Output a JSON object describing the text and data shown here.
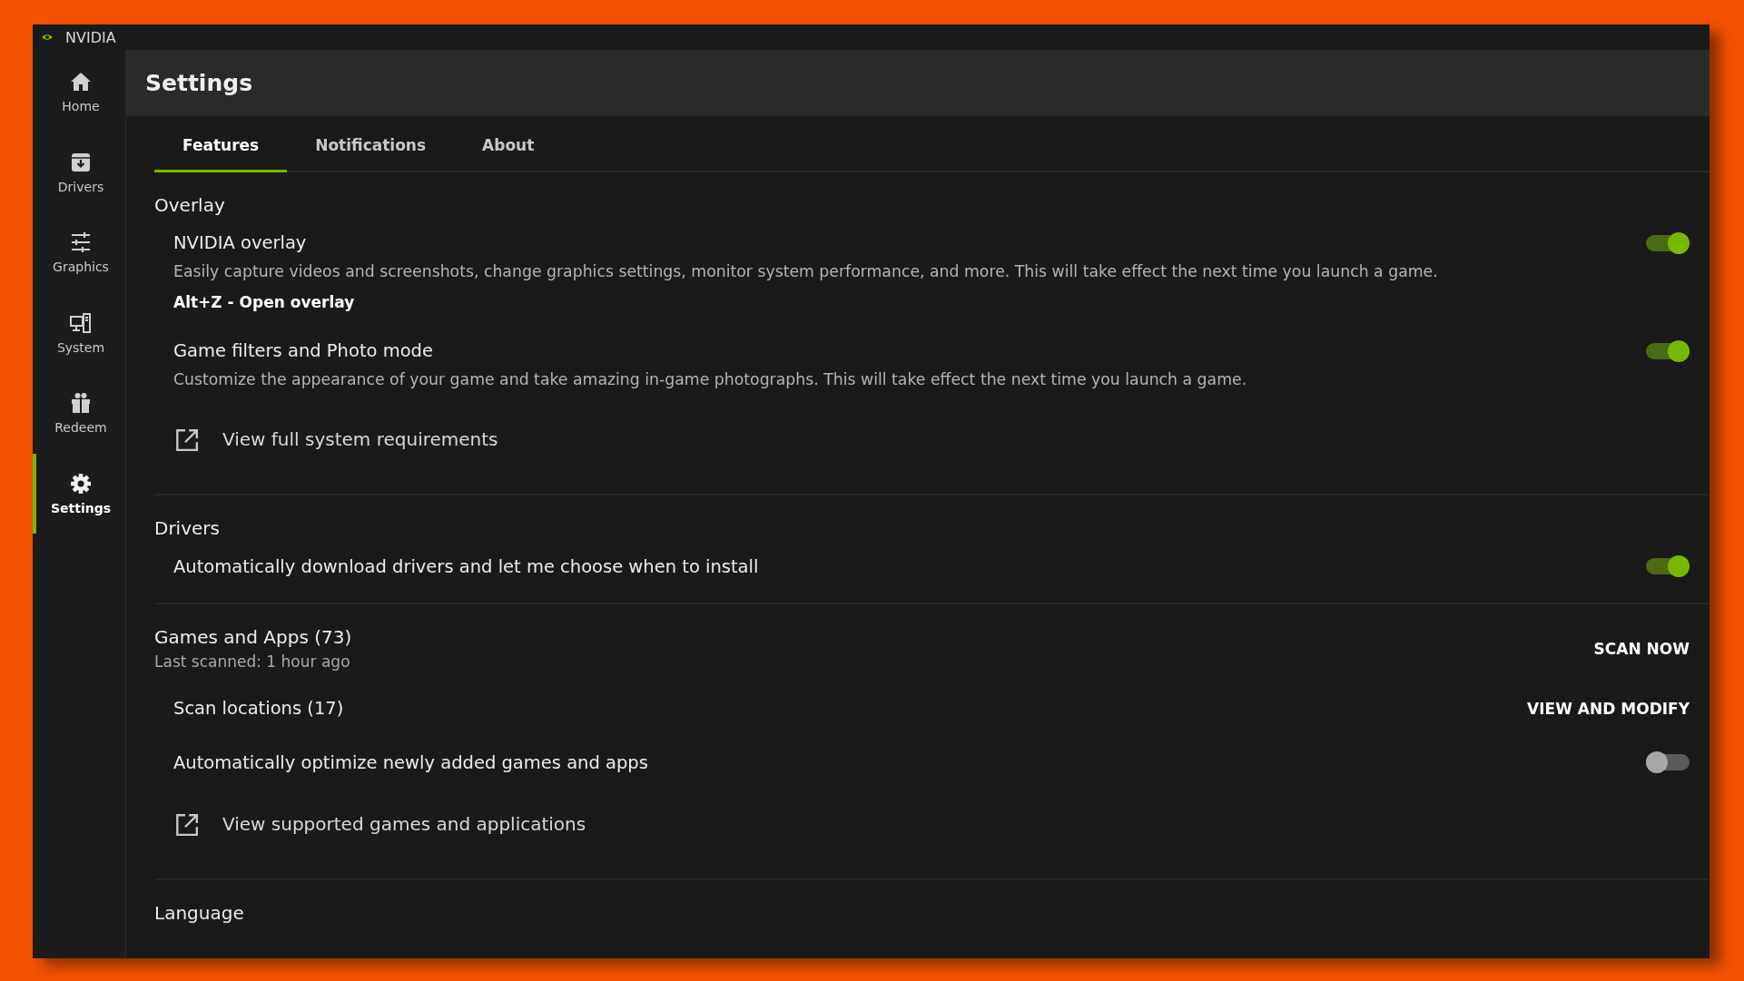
{
  "window": {
    "title": "NVIDIA"
  },
  "sidebar": {
    "items": [
      {
        "label": "Home",
        "kind": "home",
        "selected": false
      },
      {
        "label": "Drivers",
        "kind": "drivers",
        "selected": false
      },
      {
        "label": "Graphics",
        "kind": "graphics",
        "selected": false
      },
      {
        "label": "System",
        "kind": "system",
        "selected": false
      },
      {
        "label": "Redeem",
        "kind": "redeem",
        "selected": false
      },
      {
        "label": "Settings",
        "kind": "settings",
        "selected": true
      }
    ]
  },
  "header": {
    "title": "Settings"
  },
  "tabs": [
    {
      "label": "Features",
      "selected": true
    },
    {
      "label": "Notifications",
      "selected": false
    },
    {
      "label": "About",
      "selected": false
    }
  ],
  "sections": [
    {
      "title": "Overlay",
      "rows": [
        {
          "kind": "toggle",
          "label": "NVIDIA overlay",
          "description": "Easily capture videos and screenshots, change graphics settings, monitor system performance, and more. This will take effect the next time you launch a game.",
          "shortcut": "Alt+Z - Open overlay",
          "on": true
        },
        {
          "kind": "toggle",
          "label": "Game filters and Photo mode",
          "description": "Customize the appearance of your game and take amazing in-game photographs. This will take effect the next time you launch a game.",
          "on": true
        },
        {
          "kind": "link",
          "label": "View full system requirements"
        }
      ]
    },
    {
      "title": "Drivers",
      "rows": [
        {
          "kind": "toggle",
          "label": "Automatically download drivers and let me choose when to install",
          "on": true
        }
      ]
    },
    {
      "title": "Games and Apps (73)",
      "subtitle": "Last scanned: 1 hour ago",
      "action": "SCAN NOW",
      "rows": [
        {
          "kind": "action",
          "label": "Scan locations (17)",
          "action": "VIEW AND MODIFY"
        },
        {
          "kind": "toggle",
          "label": "Automatically optimize newly added games and apps",
          "on": false
        },
        {
          "kind": "link",
          "label": "View supported games and applications"
        }
      ]
    },
    {
      "title": "Language"
    }
  ]
}
